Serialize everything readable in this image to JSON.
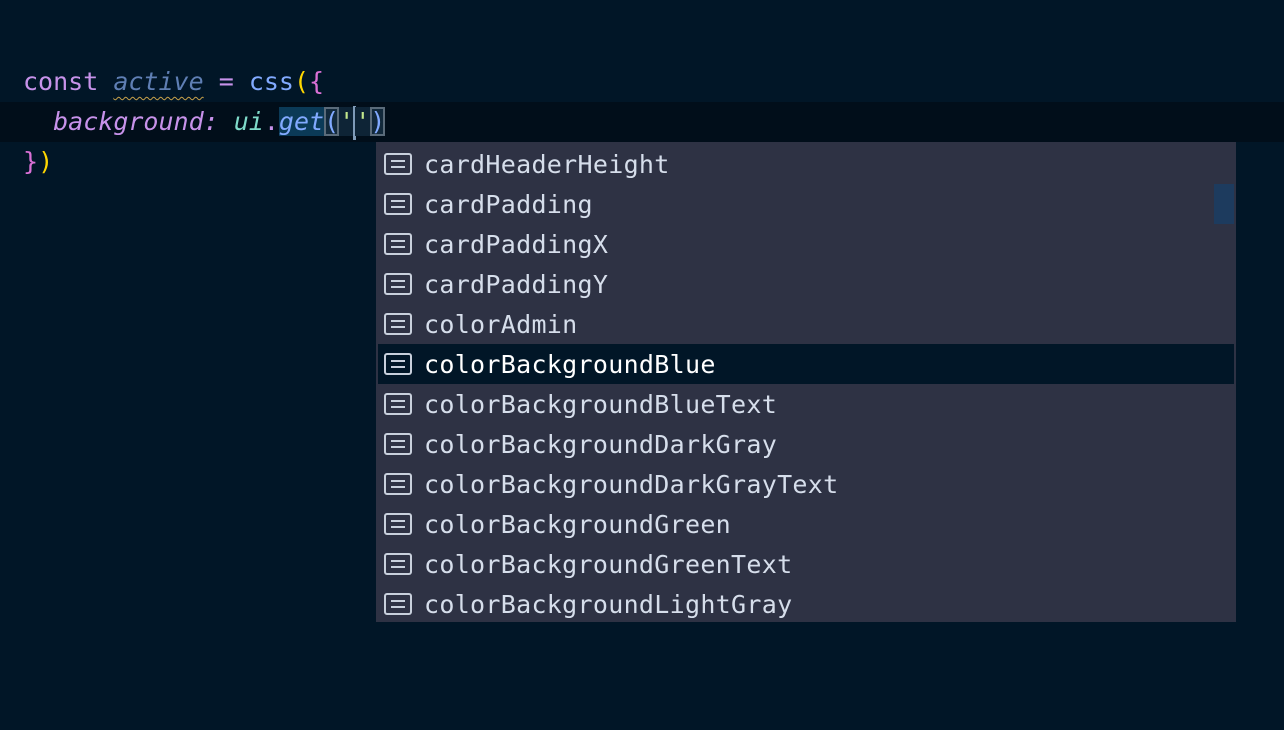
{
  "editor": {
    "lines": [
      {
        "tokens": {
          "keyword": "const",
          "variable": "active",
          "operator": "=",
          "function": "css",
          "open_paren": "(",
          "open_brace": "{"
        }
      },
      {
        "tokens": {
          "property": "background",
          "colon": ":",
          "object": "ui",
          "dot": ".",
          "method": "get",
          "open_paren": "(",
          "quote_open": "'",
          "quote_close": "'",
          "close_paren": ")"
        }
      },
      {
        "tokens": {
          "close_brace": "}",
          "close_paren": ")"
        }
      }
    ],
    "warning_on": "active"
  },
  "suggestions": {
    "icon": "list-text-icon",
    "selected_index": 5,
    "items": [
      {
        "label": "cardHeaderHeight"
      },
      {
        "label": "cardPadding"
      },
      {
        "label": "cardPaddingX"
      },
      {
        "label": "cardPaddingY"
      },
      {
        "label": "colorAdmin"
      },
      {
        "label": "colorBackgroundBlue"
      },
      {
        "label": "colorBackgroundBlueText"
      },
      {
        "label": "colorBackgroundDarkGray"
      },
      {
        "label": "colorBackgroundDarkGrayText"
      },
      {
        "label": "colorBackgroundGreen"
      },
      {
        "label": "colorBackgroundGreenText"
      },
      {
        "label": "colorBackgroundLightGray"
      }
    ]
  },
  "colors": {
    "background": "#011627",
    "current_line": "#010e1a",
    "suggest_bg": "#2e3244",
    "keyword": "#c792ea",
    "function": "#82aaff",
    "object": "#7fdbca",
    "string": "#c3e88d",
    "bracket_yellow": "#ffd700",
    "bracket_magenta": "#da70d6",
    "warning_squiggle": "#c9a24a",
    "scroll_thumb": "#1d3b5e"
  }
}
